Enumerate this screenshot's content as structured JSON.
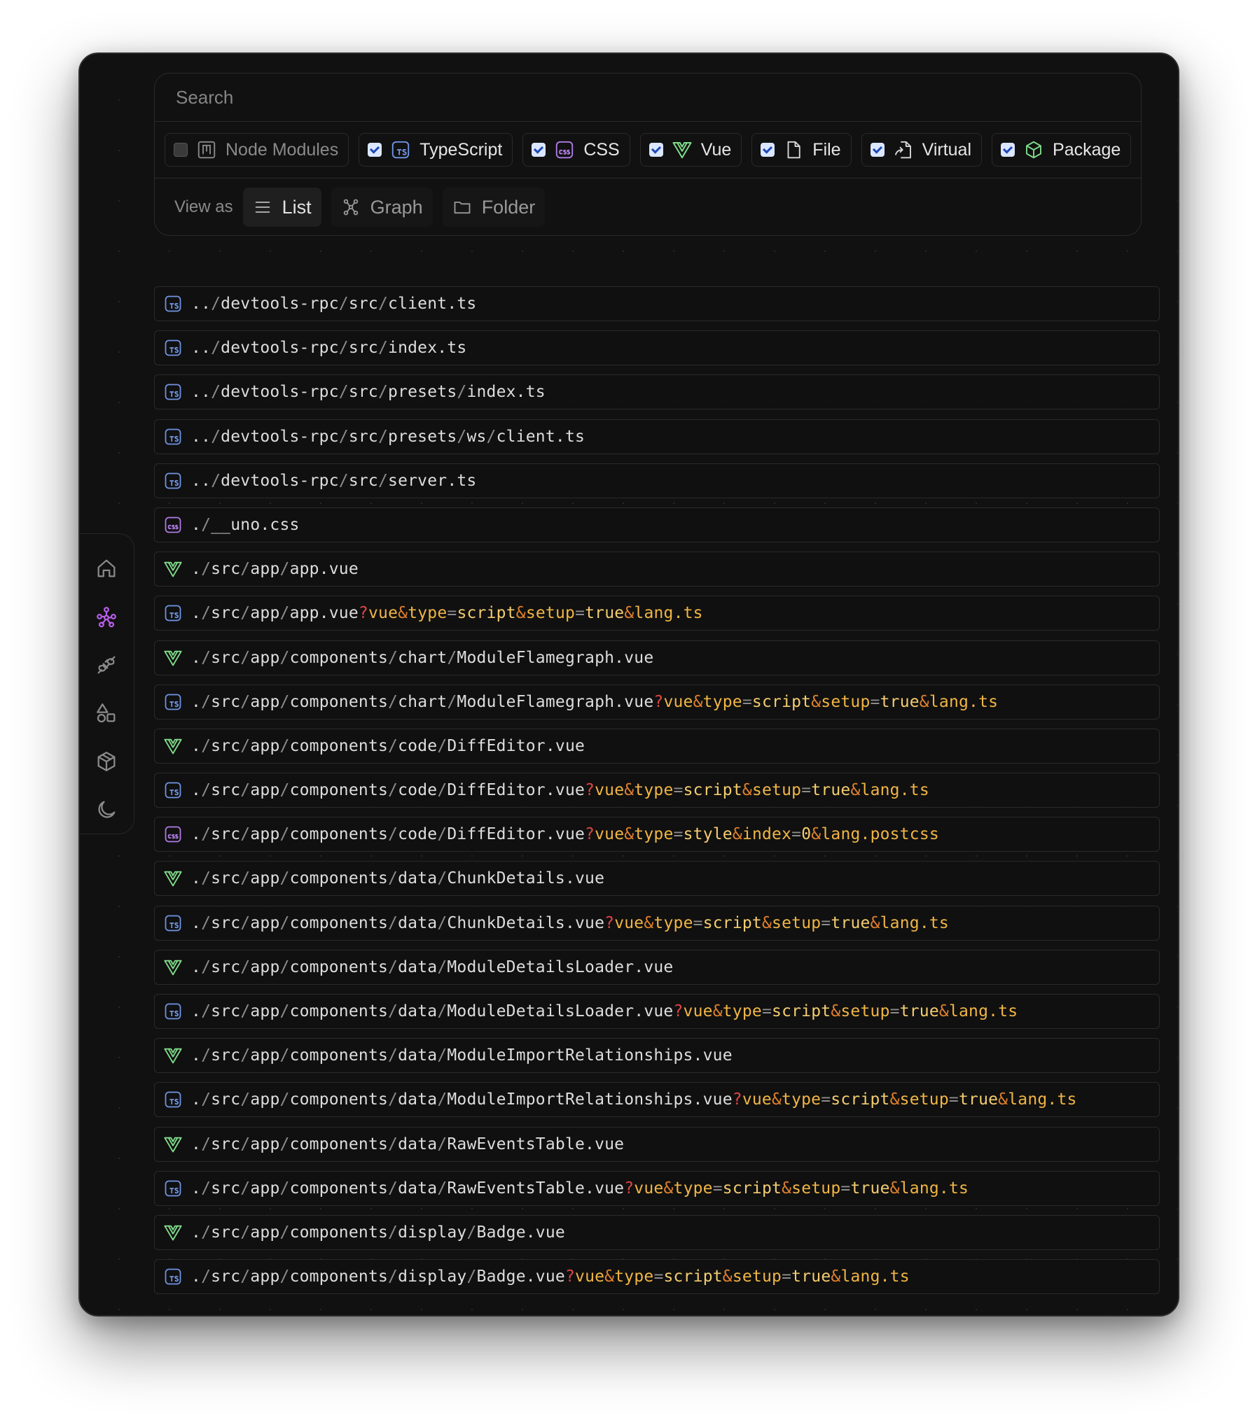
{
  "search": {
    "placeholder": "Search"
  },
  "filters": [
    {
      "label": "Node Modules",
      "checked": false,
      "icon": "node-modules-icon"
    },
    {
      "label": "TypeScript",
      "checked": true,
      "icon": "typescript-icon"
    },
    {
      "label": "CSS",
      "checked": true,
      "icon": "css-icon"
    },
    {
      "label": "Vue",
      "checked": true,
      "icon": "vue-icon"
    },
    {
      "label": "File",
      "checked": true,
      "icon": "file-icon"
    },
    {
      "label": "Virtual",
      "checked": true,
      "icon": "virtual-icon"
    },
    {
      "label": "Package",
      "checked": true,
      "icon": "package-icon"
    }
  ],
  "view": {
    "label": "View as",
    "options": [
      {
        "label": "List",
        "icon": "list-icon",
        "active": true
      },
      {
        "label": "Graph",
        "icon": "graph-icon",
        "active": false
      },
      {
        "label": "Folder",
        "icon": "folder-icon",
        "active": false
      }
    ]
  },
  "sidebar": {
    "items": [
      {
        "icon": "home-icon",
        "active": false
      },
      {
        "icon": "graph-nodes-icon",
        "active": true
      },
      {
        "icon": "plugin-icon",
        "active": false
      },
      {
        "icon": "shapes-icon",
        "active": false
      },
      {
        "icon": "package-icon",
        "active": false
      },
      {
        "icon": "moon-icon",
        "active": false
      }
    ]
  },
  "colors": {
    "accent": "#b75ee8",
    "query_key": "#f0b545",
    "query_mark": "#e04545",
    "ampersand": "#e0802c"
  },
  "modules": [
    {
      "type": "ts",
      "path": "../devtools-rpc/src/client.ts"
    },
    {
      "type": "ts",
      "path": "../devtools-rpc/src/index.ts"
    },
    {
      "type": "ts",
      "path": "../devtools-rpc/src/presets/index.ts"
    },
    {
      "type": "ts",
      "path": "../devtools-rpc/src/presets/ws/client.ts"
    },
    {
      "type": "ts",
      "path": "../devtools-rpc/src/server.ts"
    },
    {
      "type": "css",
      "path": "./__uno.css"
    },
    {
      "type": "vue",
      "path": "./src/app/app.vue"
    },
    {
      "type": "ts",
      "path": "./src/app/app.vue?vue&type=script&setup=true&lang.ts"
    },
    {
      "type": "vue",
      "path": "./src/app/components/chart/ModuleFlamegraph.vue"
    },
    {
      "type": "ts",
      "path": "./src/app/components/chart/ModuleFlamegraph.vue?vue&type=script&setup=true&lang.ts"
    },
    {
      "type": "vue",
      "path": "./src/app/components/code/DiffEditor.vue"
    },
    {
      "type": "ts",
      "path": "./src/app/components/code/DiffEditor.vue?vue&type=script&setup=true&lang.ts"
    },
    {
      "type": "css",
      "path": "./src/app/components/code/DiffEditor.vue?vue&type=style&index=0&lang.postcss"
    },
    {
      "type": "vue",
      "path": "./src/app/components/data/ChunkDetails.vue"
    },
    {
      "type": "ts",
      "path": "./src/app/components/data/ChunkDetails.vue?vue&type=script&setup=true&lang.ts"
    },
    {
      "type": "vue",
      "path": "./src/app/components/data/ModuleDetailsLoader.vue"
    },
    {
      "type": "ts",
      "path": "./src/app/components/data/ModuleDetailsLoader.vue?vue&type=script&setup=true&lang.ts"
    },
    {
      "type": "vue",
      "path": "./src/app/components/data/ModuleImportRelationships.vue"
    },
    {
      "type": "ts",
      "path": "./src/app/components/data/ModuleImportRelationships.vue?vue&type=script&setup=true&lang.ts"
    },
    {
      "type": "vue",
      "path": "./src/app/components/data/RawEventsTable.vue"
    },
    {
      "type": "ts",
      "path": "./src/app/components/data/RawEventsTable.vue?vue&type=script&setup=true&lang.ts"
    },
    {
      "type": "vue",
      "path": "./src/app/components/display/Badge.vue"
    },
    {
      "type": "ts",
      "path": "./src/app/components/display/Badge.vue?vue&type=script&setup=true&lang.ts"
    }
  ]
}
